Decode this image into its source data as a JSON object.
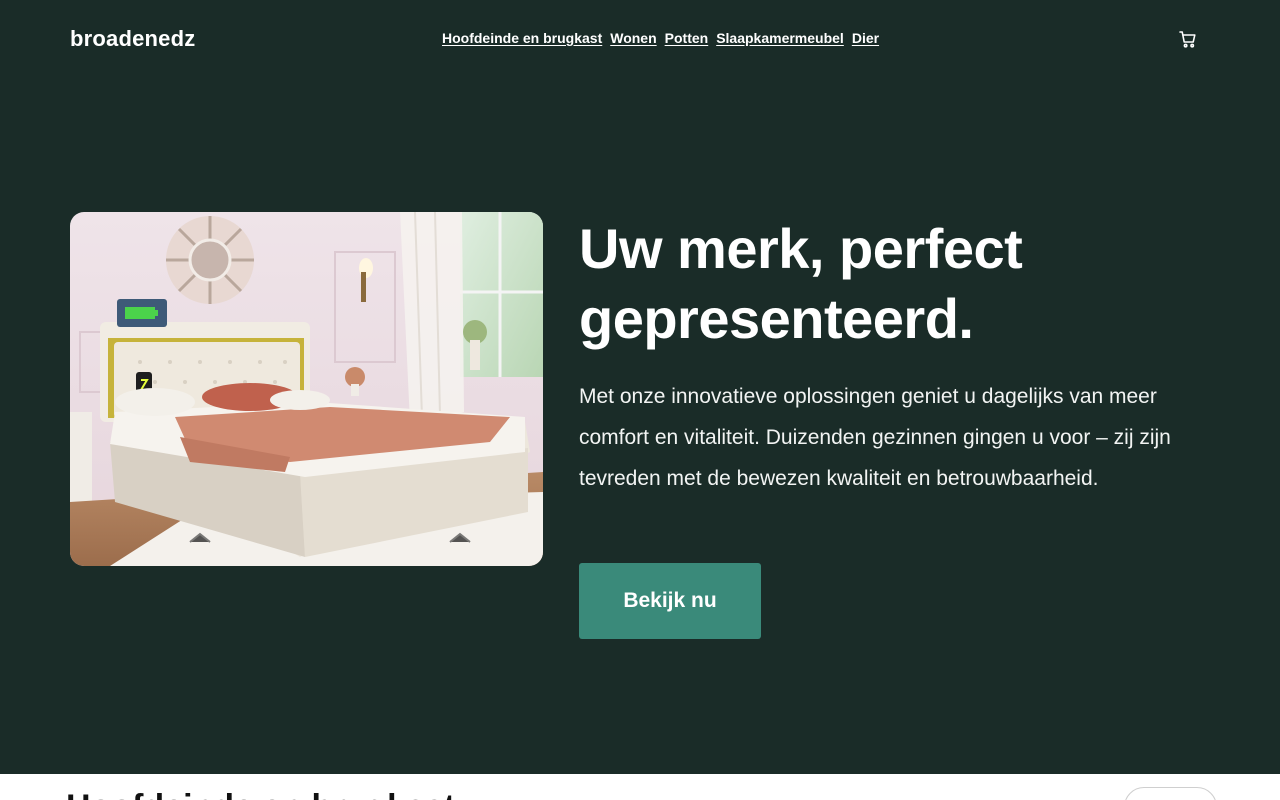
{
  "header": {
    "logo": "broadenedz",
    "nav": [
      "Hoofdeinde en brugkast",
      "Wonen",
      "Potten",
      "Slaapkamermeubel",
      "Dier"
    ],
    "cart_icon": "cart-icon"
  },
  "hero": {
    "image_alt": "bed-photo",
    "title": "Uw merk, perfect gepresenteerd.",
    "text": "Met onze innovatieve oplossingen geniet u dagelijks van meer comfort en vitaliteit. Duizenden gezinnen gingen u voor – zij zijn tevreden met de bewezen kwaliteit en betrouwbaarheid.",
    "cta_label": "Bekijk nu"
  },
  "next_section": {
    "title": "Hoofdeinde en brugkast"
  },
  "colors": {
    "background": "#1a2c28",
    "accent": "#3a8a7a",
    "text": "#ffffff"
  }
}
